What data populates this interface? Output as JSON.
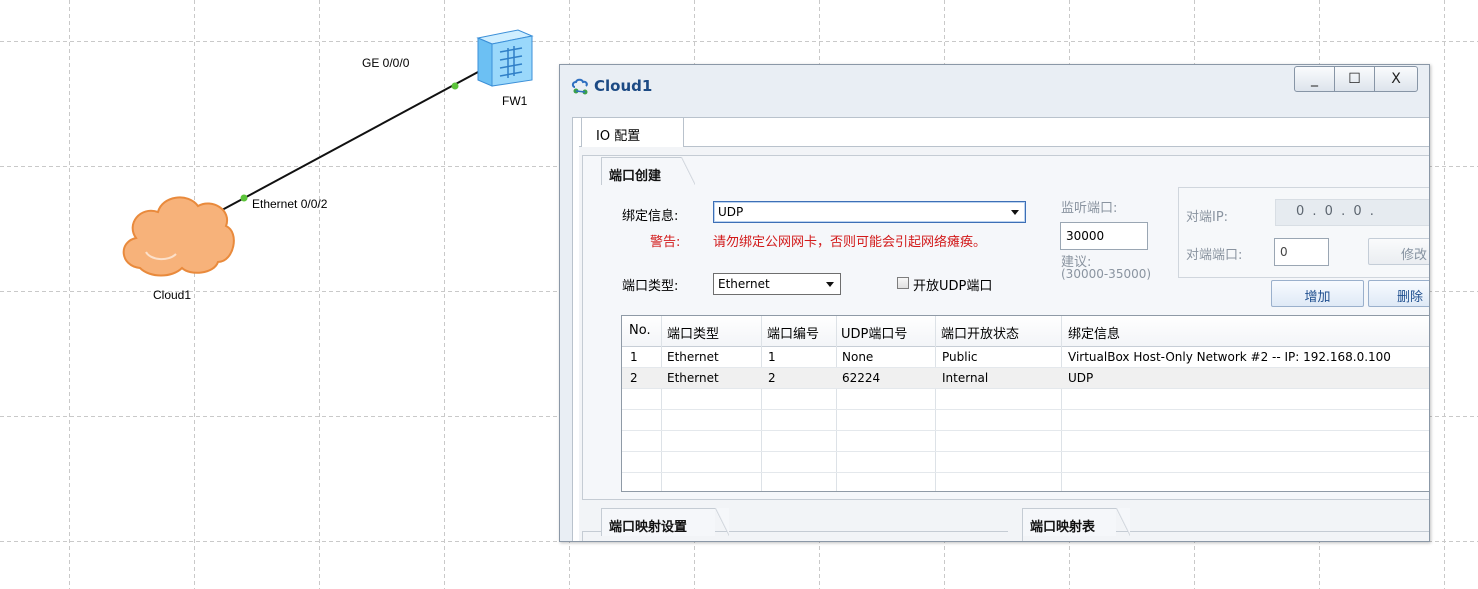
{
  "topology": {
    "nodes": {
      "cloud": {
        "label": "Cloud1",
        "icon": "cloud-icon"
      },
      "firewall": {
        "label": "FW1",
        "icon": "firewall-icon"
      }
    },
    "link": {
      "cloud_port": "Ethernet 0/0/2",
      "fw_port": "GE 0/0/0"
    }
  },
  "dialog": {
    "title": "Cloud1",
    "window_buttons": {
      "minimize": "_",
      "maximize": "☐",
      "close": "X"
    },
    "tabs": [
      "IO 配置"
    ],
    "port_create": {
      "section_title": "端口创建",
      "bind_label": "绑定信息:",
      "bind_value": "UDP",
      "warning_label": "警告:",
      "warning_text": "请勿绑定公网网卡，否则可能会引起网络瘫痪。",
      "port_type_label": "端口类型:",
      "port_type_value": "Ethernet",
      "open_udp_label": "开放UDP端口",
      "open_udp_checked": false,
      "listen_port_label": "监听端口:",
      "listen_port_value": "30000",
      "suggest_label": "建议:",
      "suggest_range": "(30000-35000)",
      "peer_ip_label": "对端IP:",
      "peer_ip_value": "0 . 0 . 0 .",
      "peer_port_label": "对端端口:",
      "peer_port_value": "0",
      "modify_button": "修改",
      "add_button": "增加",
      "delete_button": "删除"
    },
    "port_table": {
      "headers": [
        "No.",
        "端口类型",
        "端口编号",
        "UDP端口号",
        "端口开放状态",
        "绑定信息"
      ],
      "rows": [
        [
          "1",
          "Ethernet",
          "1",
          "None",
          "Public",
          "VirtualBox Host-Only Network #2 -- IP: 192.168.0.100"
        ],
        [
          "2",
          "Ethernet",
          "2",
          "62224",
          "Internal",
          "UDP"
        ]
      ]
    },
    "port_mapping_settings": {
      "section_title": "端口映射设置"
    },
    "port_mapping_table": {
      "section_title": "端口映射表"
    }
  },
  "colors": {
    "title_text": "#1c4a84",
    "warning": "#d21a1a",
    "link_endpoint": "#5cc43a",
    "cloud_fill": "#f7b27a"
  }
}
